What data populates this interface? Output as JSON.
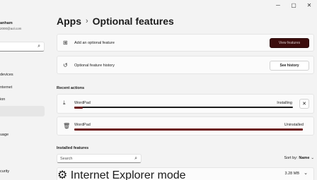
{
  "window": {
    "minimize": "─",
    "maximize": "▢",
    "close": "✕"
  },
  "sidebar": {
    "user_name": "anham",
    "user_email": "2000@aol.com",
    "search_icon": "search-icon",
    "items": [
      {
        "label": "devices"
      },
      {
        "label": "nternet"
      },
      {
        "label": "ion"
      },
      {
        "label": ""
      },
      {
        "label": "uage"
      },
      {
        "label": "curity"
      }
    ]
  },
  "header": {
    "parent": "Apps",
    "separator": "›",
    "title": "Optional features"
  },
  "add_card": {
    "icon": "add-grid-icon",
    "label": "Add an optional feature",
    "button": "View features"
  },
  "history_card": {
    "icon": "history-icon",
    "label": "Optional feature history",
    "button": "See history"
  },
  "recent": {
    "heading": "Recent actions",
    "items": [
      {
        "icon": "download-icon",
        "name": "WordPad",
        "status": "Installing",
        "progress": 0.04,
        "close": "✕"
      },
      {
        "icon": "trash-icon",
        "name": "WordPad",
        "status": "Uninstalled",
        "progress": 1.0
      }
    ]
  },
  "installed": {
    "heading": "Installed features",
    "search_placeholder": "Search",
    "sort_label": "Sort by:",
    "sort_value": "Name",
    "sort_chevron": "⌄",
    "items": [
      {
        "icon": "gear-icon",
        "name": "Internet Explorer mode",
        "size": "3.28 MB",
        "chevron": "⌄"
      }
    ]
  },
  "colors": {
    "accent": "#3d0e0e",
    "progress": "#6b1414"
  }
}
